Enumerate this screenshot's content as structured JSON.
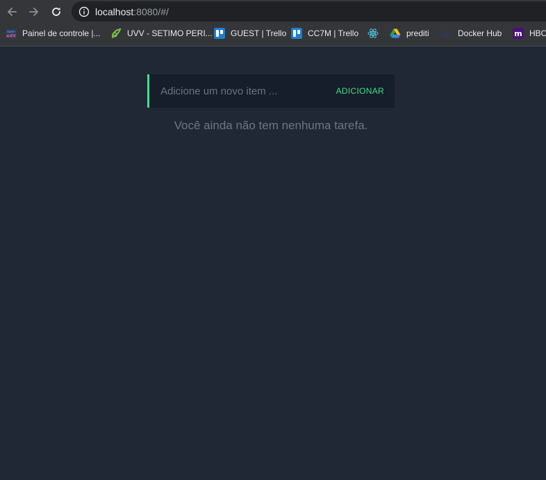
{
  "browser": {
    "url_host": "localhost",
    "url_rest": ":8080/#/",
    "bookmarks": [
      {
        "label": "Painel de controle |...",
        "icon": "openedx-icon"
      },
      {
        "label": "UVV - SETIMO PERI...",
        "icon": "moodle-leaf-icon"
      },
      {
        "label": "GUEST | Trello",
        "icon": "trello-icon"
      },
      {
        "label": "CC7M | Trello",
        "icon": "trello-icon"
      },
      {
        "label": "",
        "icon": "react-icon"
      },
      {
        "label": "prediti",
        "icon": "google-drive-icon"
      },
      {
        "label": "Docker Hub",
        "icon": "docker-icon"
      },
      {
        "label": "HBO",
        "icon": "hbo-max-icon"
      }
    ]
  },
  "todo": {
    "input_placeholder": "Adicione um novo item ...",
    "input_value": "",
    "add_label": "ADICIONAR",
    "empty_message": "Você ainda não tem nenhuma tarefa."
  },
  "colors": {
    "background": "#202836",
    "form_background": "#161d2b",
    "accent": "#3fe08a",
    "muted_text": "#6d7585"
  }
}
